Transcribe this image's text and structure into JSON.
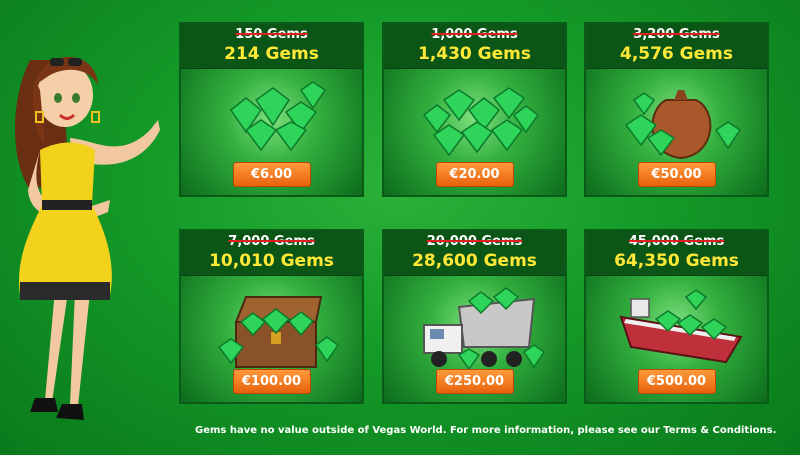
{
  "packages": [
    {
      "old": "150 Gems",
      "new": "214 Gems",
      "price": "€6.00",
      "art": "gem-pile-small-icon"
    },
    {
      "old": "1,000 Gems",
      "new": "1,430 Gems",
      "price": "€20.00",
      "art": "gem-pile-large-icon"
    },
    {
      "old": "3,200 Gems",
      "new": "4,576 Gems",
      "price": "€50.00",
      "art": "gem-sack-icon"
    },
    {
      "old": "7,000 Gems",
      "new": "10,010 Gems",
      "price": "€100.00",
      "art": "treasure-chest-icon"
    },
    {
      "old": "20,000 Gems",
      "new": "28,600 Gems",
      "price": "€250.00",
      "art": "dump-truck-icon"
    },
    {
      "old": "45,000 Gems",
      "new": "64,350 Gems",
      "price": "€500.00",
      "art": "cargo-ship-icon"
    }
  ],
  "footer": "Gems have no value outside of Vegas World. For more information, please see our Terms & Conditions.",
  "colors": {
    "background": "#149a28",
    "header": "#0b5616",
    "new_price": "#ffe936",
    "button": "#f07a1a",
    "strike": "#e02020"
  }
}
